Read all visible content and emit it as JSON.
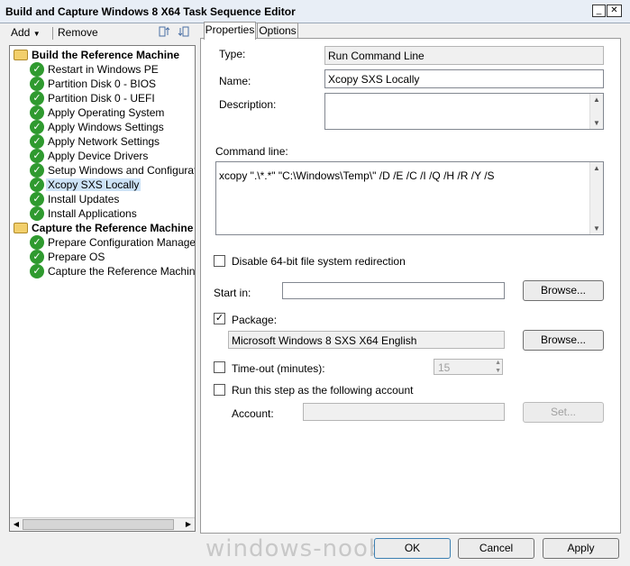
{
  "window": {
    "title": "Build and Capture Windows 8 X64 Task Sequence Editor"
  },
  "toolbar": {
    "add_label": "Add",
    "remove_label": "Remove"
  },
  "tree": {
    "groups": [
      {
        "label": "Build the Reference Machine",
        "items": [
          "Restart in Windows PE",
          "Partition Disk 0 - BIOS",
          "Partition Disk 0 - UEFI",
          "Apply Operating System",
          "Apply Windows Settings",
          "Apply Network Settings",
          "Apply Device Drivers",
          "Setup Windows and Configuration",
          "Xcopy SXS Locally",
          "Install Updates",
          "Install Applications"
        ]
      },
      {
        "label": "Capture the Reference Machine",
        "items": [
          "Prepare Configuration Manager Cli",
          "Prepare OS",
          "Capture the Reference Machine"
        ]
      }
    ],
    "selected": "Xcopy SXS Locally"
  },
  "tabs": {
    "properties": "Properties",
    "options": "Options"
  },
  "form": {
    "type_label": "Type:",
    "type_value": "Run Command Line",
    "name_label": "Name:",
    "name_value": "Xcopy SXS Locally",
    "description_label": "Description:",
    "description_value": "",
    "command_line_label": "Command line:",
    "command_line_value": "xcopy \".\\*.*\" \"C:\\Windows\\Temp\\\" /D /E /C /I /Q /H /R /Y /S",
    "disable64_label": "Disable 64-bit file system redirection",
    "disable64_checked": false,
    "start_in_label": "Start in:",
    "start_in_value": "",
    "browse_label": "Browse...",
    "package_label": "Package:",
    "package_checked": true,
    "package_value": "Microsoft Windows 8 SXS X64 English",
    "timeout_label": "Time-out (minutes):",
    "timeout_checked": false,
    "timeout_value": "15",
    "run_as_label": "Run this step as the following account",
    "run_as_checked": false,
    "account_label": "Account:",
    "account_value": "",
    "set_label": "Set..."
  },
  "footer": {
    "ok_label": "OK",
    "cancel_label": "Cancel",
    "apply_label": "Apply"
  },
  "watermark": "windows-noob.com"
}
